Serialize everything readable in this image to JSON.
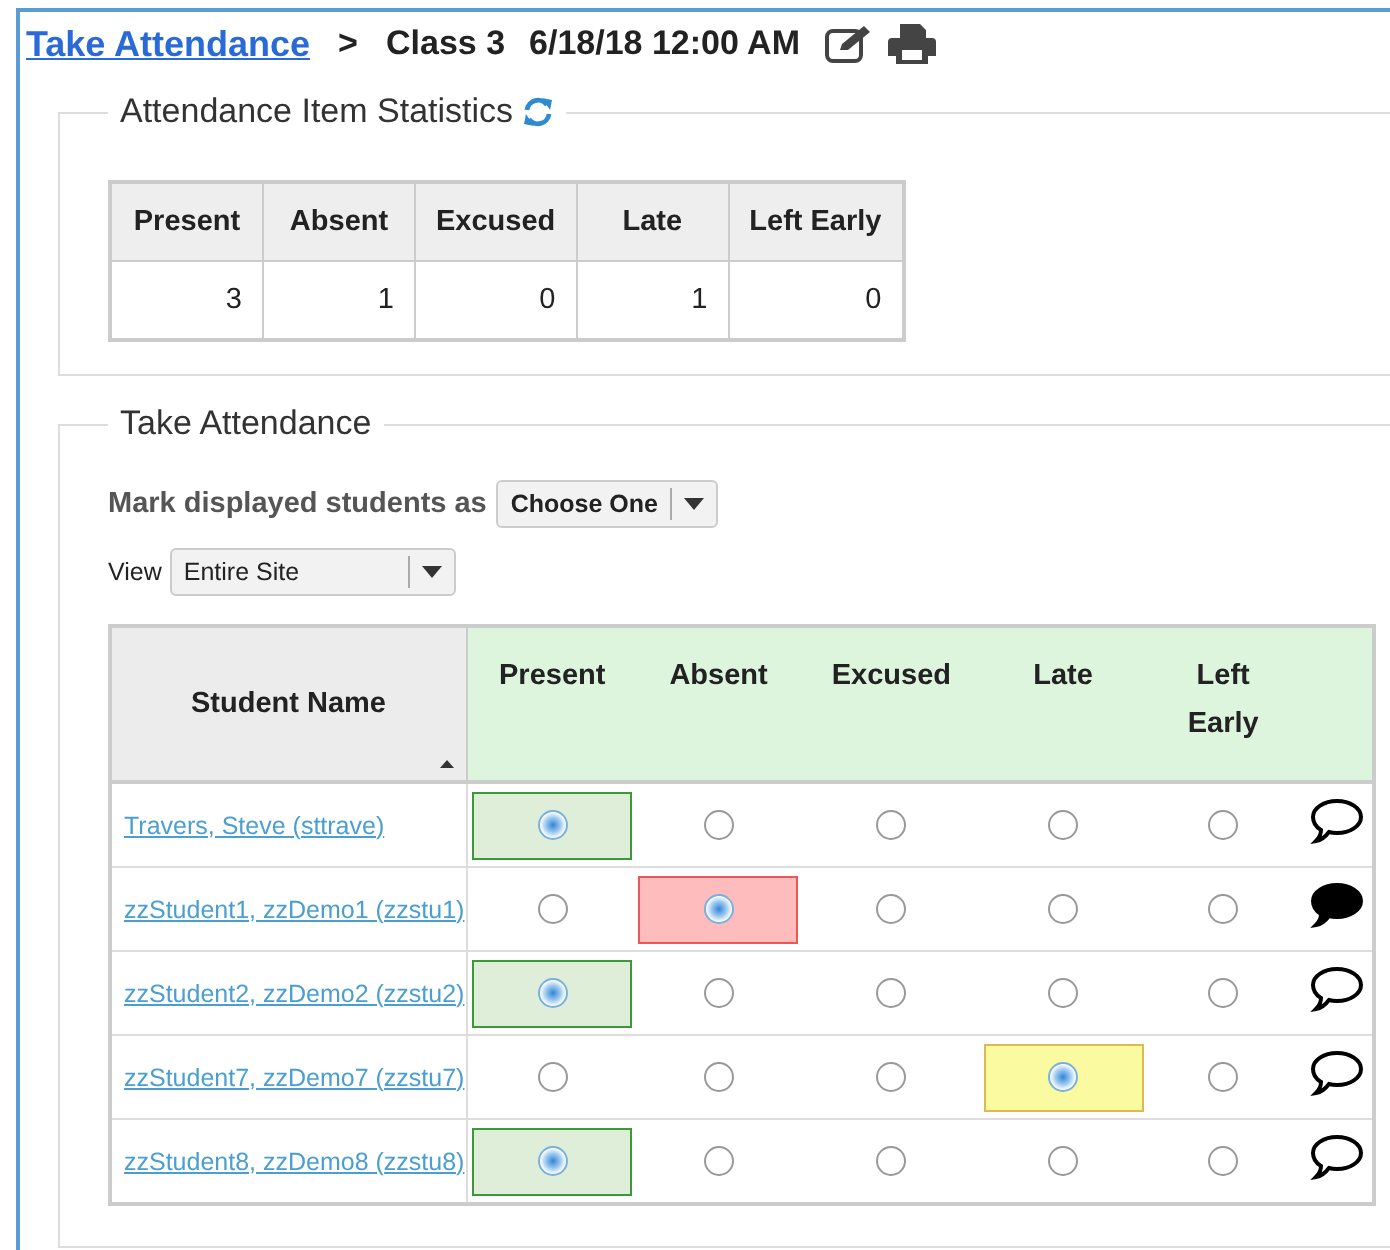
{
  "header": {
    "link": "Take Attendance",
    "separator": ">",
    "class_name": "Class 3",
    "date": "6/18/18 12:00 AM"
  },
  "statistics": {
    "legend": "Attendance Item Statistics",
    "columns": [
      "Present",
      "Absent",
      "Excused",
      "Late",
      "Left Early"
    ],
    "values": [
      "3",
      "1",
      "0",
      "1",
      "0"
    ]
  },
  "take_attendance": {
    "legend": "Take Attendance",
    "mark_label": "Mark displayed students as",
    "mark_value": "Choose One",
    "view_label": "View",
    "view_value": "Entire Site",
    "columns": [
      "Student Name",
      "Present",
      "Absent",
      "Excused",
      "Late",
      "Left Early"
    ],
    "rows": [
      {
        "name": "Travers, Steve (sttrave)",
        "statuses": [
          {
            "selected": true
          },
          {
            "selected": false
          },
          {
            "selected": false
          },
          {
            "selected": false
          },
          {
            "selected": false
          }
        ],
        "has_comment": false
      },
      {
        "name": "zzStudent1, zzDemo1 (zzstu1)",
        "statuses": [
          {
            "selected": false
          },
          {
            "selected": true
          },
          {
            "selected": false
          },
          {
            "selected": false
          },
          {
            "selected": false
          }
        ],
        "has_comment": true
      },
      {
        "name": "zzStudent2, zzDemo2 (zzstu2)",
        "statuses": [
          {
            "selected": true
          },
          {
            "selected": false
          },
          {
            "selected": false
          },
          {
            "selected": false
          },
          {
            "selected": false
          }
        ],
        "has_comment": false
      },
      {
        "name": "zzStudent7, zzDemo7 (zzstu7)",
        "statuses": [
          {
            "selected": false
          },
          {
            "selected": false
          },
          {
            "selected": false
          },
          {
            "selected": true
          },
          {
            "selected": false
          }
        ],
        "has_comment": false
      },
      {
        "name": "zzStudent8, zzDemo8 (zzstu8)",
        "statuses": [
          {
            "selected": true
          },
          {
            "selected": false
          },
          {
            "selected": false
          },
          {
            "selected": false
          },
          {
            "selected": false
          }
        ],
        "has_comment": false
      }
    ]
  }
}
